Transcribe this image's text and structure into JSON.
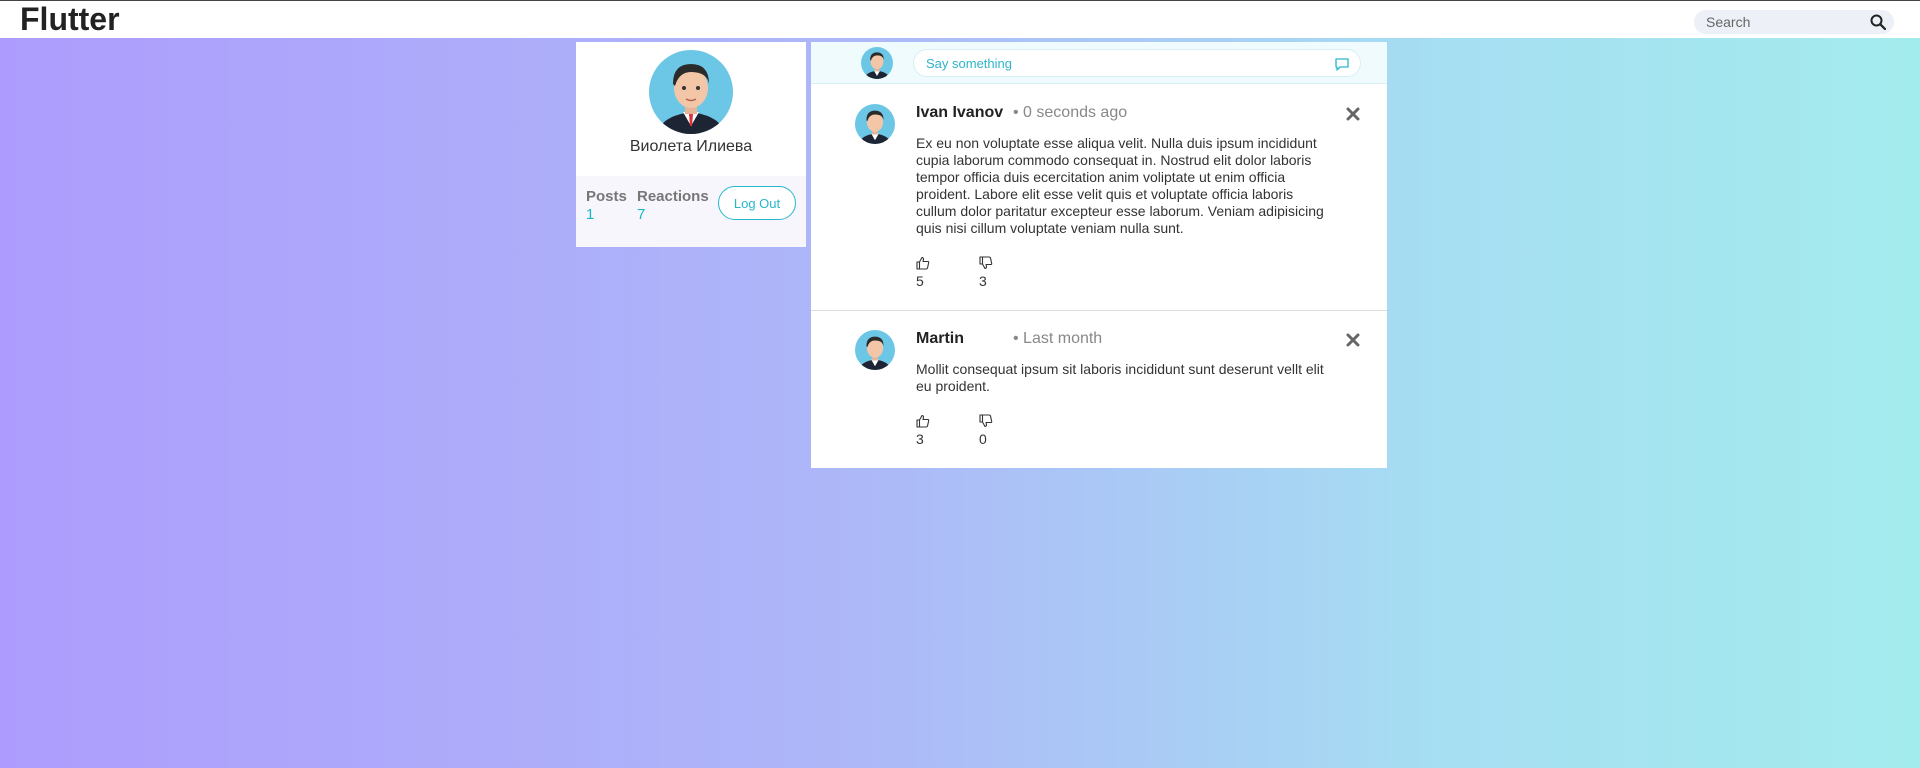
{
  "app": {
    "title": "Flutter"
  },
  "search": {
    "placeholder": "Search"
  },
  "profile": {
    "name": "Виолета Илиева",
    "stats": {
      "posts_label": "Posts",
      "posts_value": "1",
      "reactions_label": "Reactions",
      "reactions_value": "7"
    },
    "logout_label": "Log Out"
  },
  "composer": {
    "placeholder": "Say something"
  },
  "posts": [
    {
      "author": "Ivan Ivanov",
      "time": "• 0 seconds ago",
      "body": "Ex eu non voluptate esse aliqua velit. Nulla duis ipsum incididunt cupia laborum commodo consequat in. Nostrud elit dolor laboris tempor officia duis ecercitation anim voliptate ut enim officia proident. Labore elit esse velit quis et voluptate officia laboris cullum dolor paritatur excepteur esse laborum. Veniam adipisicing quis nisi cillum voluptate veniam nulla sunt.",
      "likes": "5",
      "dislikes": "3"
    },
    {
      "author": "Martin",
      "time": "• Last month",
      "body": "Mollit consequat ipsum sit laboris incididunt sunt deserunt vellt elit eu proident.",
      "likes": "3",
      "dislikes": "0"
    }
  ],
  "colors": {
    "accent": "#27b7cc",
    "brand_text": "#222222"
  },
  "icons": {
    "search": "search-icon",
    "comment": "comment-icon",
    "close": "close-icon",
    "like": "thumbs-up-icon",
    "dislike": "thumbs-down-icon"
  }
}
